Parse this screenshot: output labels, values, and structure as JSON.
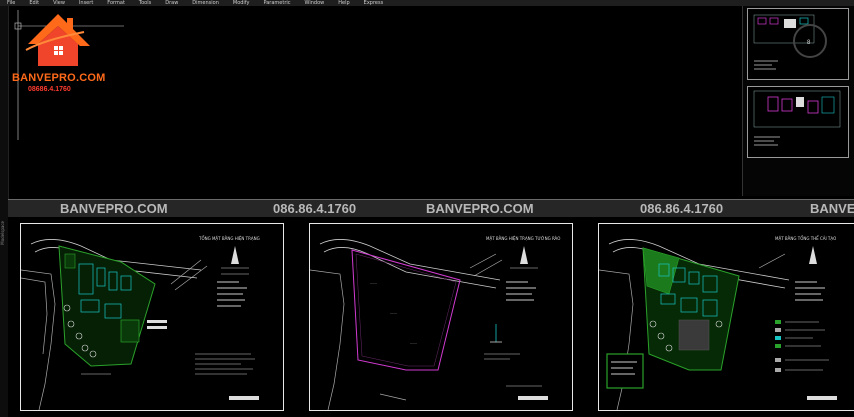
{
  "menu": [
    "File",
    "Edit",
    "View",
    "Insert",
    "Format",
    "Tools",
    "Draw",
    "Dimension",
    "Modify",
    "Parametric",
    "Window",
    "Help",
    "Express"
  ],
  "logo": {
    "brand": "BANVEPRO.COM",
    "phone": "08686.4.1760"
  },
  "left_strip_label": "Modelspace",
  "banner": {
    "items": [
      "BANVEPRO.COM",
      "086.86.4.1760",
      "BANVEPRO.COM",
      "086.86.4.1760",
      "BANVEPRO.COM"
    ]
  },
  "sheets": [
    {
      "title": "TỔNG MẶT BẰNG HIỆN TRẠNG"
    },
    {
      "title": "MẶT BẰNG HIỆN TRẠNG TƯỜNG RÀO"
    },
    {
      "title": "MẶT BẰNG TỔNG THỂ CẢI TẠO"
    }
  ],
  "colors": {
    "background": "#000000",
    "logo_orange": "#ff6a1a",
    "logo_red": "#ff3b2f",
    "banner_text": "#b8b8b8",
    "site_green": "#2aa12a",
    "building_cyan": "#19c6c6",
    "boundary_magenta": "#d23ad2"
  }
}
